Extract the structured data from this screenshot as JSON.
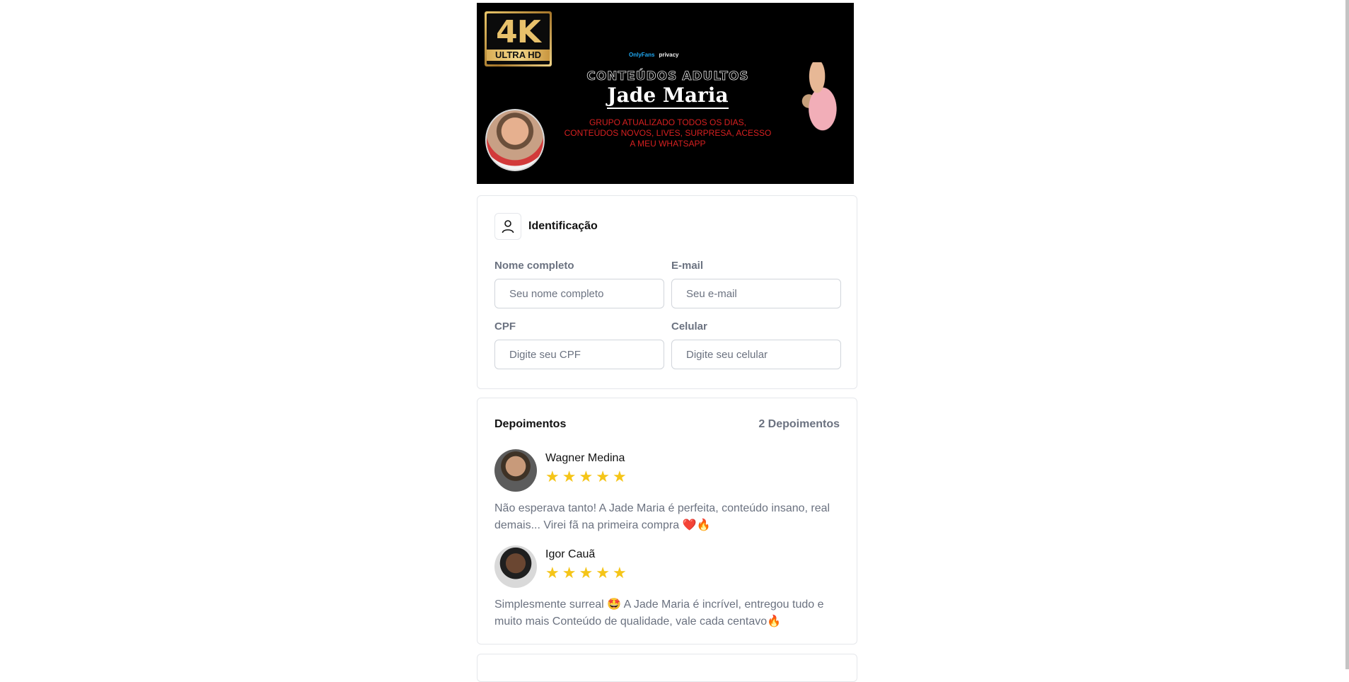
{
  "banner": {
    "badge_big": "4K",
    "badge_small_prefix": "ULTRA ",
    "badge_small_bold": "HD",
    "platform_1": "OnlyFans",
    "platform_2": "privacy",
    "heading": "CONTEÚDOS ADULTOS",
    "name": "Jade Maria",
    "subtitle": "GRUPO ATUALIZADO TODOS OS DIAS, CONTEÚDOS NOVOS, LIVES, SURPRESA, ACESSO A MEU WHATSAPP"
  },
  "identification": {
    "title": "Identificação",
    "fields": [
      {
        "label": "Nome completo",
        "placeholder": "Seu nome completo"
      },
      {
        "label": "E-mail",
        "placeholder": "Seu e-mail"
      },
      {
        "label": "CPF",
        "placeholder": "Digite seu CPF"
      },
      {
        "label": "Celular",
        "placeholder": "Digite seu celular"
      }
    ]
  },
  "testimonials": {
    "title": "Depoimentos",
    "count": "2 Depoimentos",
    "star_glyph": "★",
    "items": [
      {
        "name": "Wagner Medina",
        "rating": 5,
        "text": "Não esperava tanto! A Jade Maria é perfeita, conteúdo insano, real demais... Virei fã na primeira compra ❤️🔥"
      },
      {
        "name": "Igor Cauã",
        "rating": 5,
        "text": "Simplesmente surreal 🤩 A Jade Maria é incrível, entregou tudo e muito mais Conteúdo de qualidade, vale cada centavo🔥"
      }
    ]
  },
  "colors": {
    "star": "#f5c518",
    "banner_red": "#d62020",
    "muted_text": "#6b7280",
    "border": "#e5e7eb"
  },
  "icons": {
    "identification": "user-icon"
  }
}
